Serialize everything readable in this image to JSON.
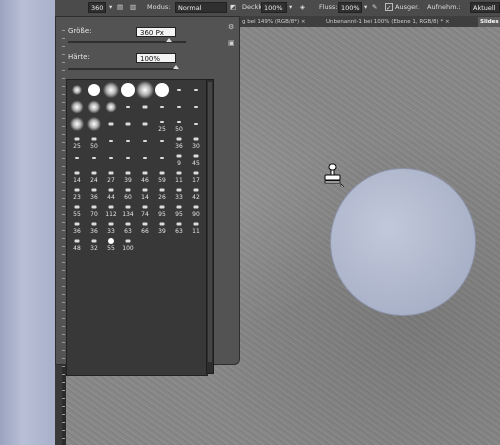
{
  "options_bar": {
    "brush_size": "360",
    "mode_label": "Modus:",
    "mode_value": "Normal",
    "opacity_label": "Deckkr.:",
    "opacity_value": "100%",
    "flow_label": "Fluss:",
    "flow_value": "100%",
    "aligned_label": "Ausger.",
    "sample_label": "Aufnehm.:",
    "sample_value": "Aktuell"
  },
  "tabs": [
    {
      "label": "g bei 149% (RGB/8*) ×"
    },
    {
      "label": "Unbenannt-1 bei 100% (Ebene 1, RGB/8) * ×"
    },
    {
      "label": "Slides"
    }
  ],
  "brush_panel": {
    "size_label": "Größe:",
    "size_value": "360 Px",
    "hardness_label": "Härte:",
    "hardness_value": "100%",
    "size_level": 0.86,
    "hardness_level": 1.0,
    "presets": [
      {
        "n": "",
        "t": "soft",
        "s": 6
      },
      {
        "n": "",
        "t": "hard",
        "s": 12
      },
      {
        "n": "",
        "t": "soft",
        "s": 12
      },
      {
        "n": "",
        "t": "hard",
        "s": 14
      },
      {
        "n": "",
        "t": "soft",
        "s": 14
      },
      {
        "n": "",
        "t": "hard",
        "s": 14
      },
      {
        "n": "",
        "t": "dot",
        "s": 2
      },
      {
        "n": "",
        "t": "dot",
        "s": 2
      },
      {
        "n": "",
        "t": "soft",
        "s": 9
      },
      {
        "n": "",
        "t": "soft",
        "s": 9
      },
      {
        "n": "",
        "t": "soft",
        "s": 7
      },
      {
        "n": "",
        "t": "dot",
        "s": 2
      },
      {
        "n": "",
        "t": "dot",
        "s": 3
      },
      {
        "n": "",
        "t": "dot",
        "s": 2
      },
      {
        "n": "",
        "t": "dot",
        "s": 2
      },
      {
        "n": "",
        "t": "dot",
        "s": 2
      },
      {
        "n": "",
        "t": "soft",
        "s": 10
      },
      {
        "n": "",
        "t": "soft",
        "s": 10
      },
      {
        "n": "",
        "t": "dot",
        "s": 3
      },
      {
        "n": "",
        "t": "dot",
        "s": 3
      },
      {
        "n": "",
        "t": "dot",
        "s": 3
      },
      {
        "n": "25",
        "t": "dot",
        "s": 2
      },
      {
        "n": "50",
        "t": "dot",
        "s": 2
      },
      {
        "n": "",
        "t": "dot",
        "s": 2
      },
      {
        "n": "25",
        "t": "dot",
        "s": 3
      },
      {
        "n": "50",
        "t": "dot",
        "s": 3
      },
      {
        "n": "",
        "t": "dot",
        "s": 2
      },
      {
        "n": "",
        "t": "dot",
        "s": 2
      },
      {
        "n": "",
        "t": "dot",
        "s": 2
      },
      {
        "n": "",
        "t": "dot",
        "s": 2
      },
      {
        "n": "36",
        "t": "dot",
        "s": 3
      },
      {
        "n": "30",
        "t": "dot",
        "s": 3
      },
      {
        "n": "",
        "t": "dot",
        "s": 2
      },
      {
        "n": "",
        "t": "dot",
        "s": 2
      },
      {
        "n": "",
        "t": "dot",
        "s": 2
      },
      {
        "n": "",
        "t": "dot",
        "s": 2
      },
      {
        "n": "",
        "t": "dot",
        "s": 2
      },
      {
        "n": "",
        "t": "dot",
        "s": 2
      },
      {
        "n": "9",
        "t": "dot",
        "s": 3
      },
      {
        "n": "45",
        "t": "dot",
        "s": 3
      },
      {
        "n": "14",
        "t": "dot",
        "s": 3
      },
      {
        "n": "24",
        "t": "dot",
        "s": 3
      },
      {
        "n": "27",
        "t": "dot",
        "s": 3
      },
      {
        "n": "39",
        "t": "dot",
        "s": 3
      },
      {
        "n": "46",
        "t": "dot",
        "s": 3
      },
      {
        "n": "59",
        "t": "dot",
        "s": 3
      },
      {
        "n": "11",
        "t": "dot",
        "s": 3
      },
      {
        "n": "17",
        "t": "dot",
        "s": 3
      },
      {
        "n": "23",
        "t": "dot",
        "s": 3
      },
      {
        "n": "36",
        "t": "dot",
        "s": 3
      },
      {
        "n": "44",
        "t": "dot",
        "s": 3
      },
      {
        "n": "60",
        "t": "dot",
        "s": 3
      },
      {
        "n": "14",
        "t": "dot",
        "s": 3
      },
      {
        "n": "26",
        "t": "dot",
        "s": 3
      },
      {
        "n": "33",
        "t": "dot",
        "s": 3
      },
      {
        "n": "42",
        "t": "dot",
        "s": 3
      },
      {
        "n": "55",
        "t": "dot",
        "s": 3
      },
      {
        "n": "70",
        "t": "dot",
        "s": 3
      },
      {
        "n": "112",
        "t": "dot",
        "s": 3
      },
      {
        "n": "134",
        "t": "dot",
        "s": 3
      },
      {
        "n": "74",
        "t": "dot",
        "s": 3
      },
      {
        "n": "95",
        "t": "dot",
        "s": 3
      },
      {
        "n": "95",
        "t": "dot",
        "s": 3
      },
      {
        "n": "90",
        "t": "dot",
        "s": 3
      },
      {
        "n": "36",
        "t": "dot",
        "s": 3
      },
      {
        "n": "36",
        "t": "dot",
        "s": 3
      },
      {
        "n": "33",
        "t": "dot",
        "s": 3
      },
      {
        "n": "63",
        "t": "dot",
        "s": 3
      },
      {
        "n": "66",
        "t": "dot",
        "s": 3
      },
      {
        "n": "39",
        "t": "dot",
        "s": 3
      },
      {
        "n": "63",
        "t": "dot",
        "s": 3
      },
      {
        "n": "11",
        "t": "dot",
        "s": 3
      },
      {
        "n": "48",
        "t": "dot",
        "s": 3
      },
      {
        "n": "32",
        "t": "dot",
        "s": 3
      },
      {
        "n": "55",
        "t": "hard",
        "s": 6
      },
      {
        "n": "100",
        "t": "dot",
        "s": 3
      }
    ]
  }
}
